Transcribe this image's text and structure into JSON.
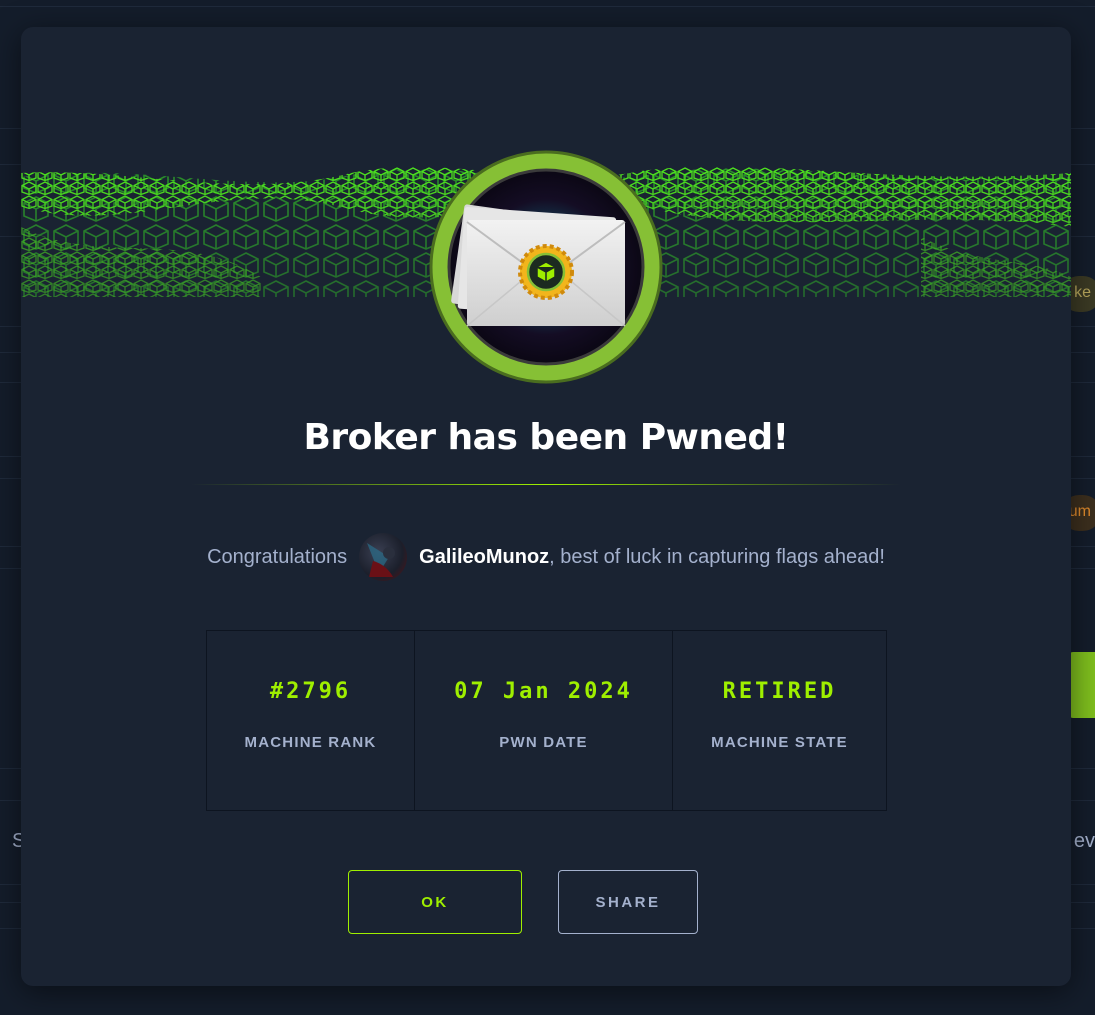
{
  "background": {
    "right_text_1": "ke",
    "right_text_2": "um",
    "left_letter_1": "S",
    "right_text_3": "ev"
  },
  "modal": {
    "machine_icon": "envelope-with-badge-icon",
    "title": "Broker has been Pwned!",
    "congrats": {
      "prefix": "Congratulations",
      "username": "GalileoMunoz",
      "suffix": ", best of luck in capturing flags ahead!"
    },
    "stats": [
      {
        "value": "#2796",
        "label": "MACHINE RANK"
      },
      {
        "value": "07 Jan 2024",
        "label": "PWN DATE"
      },
      {
        "value": "RETIRED",
        "label": "MACHINE STATE"
      }
    ],
    "buttons": {
      "ok": "OK",
      "share": "SHARE"
    }
  },
  "colors": {
    "accent": "#9fef00",
    "modal_bg": "#1a2332",
    "page_bg": "#141d2b",
    "muted_text": "#a4b1cd"
  }
}
